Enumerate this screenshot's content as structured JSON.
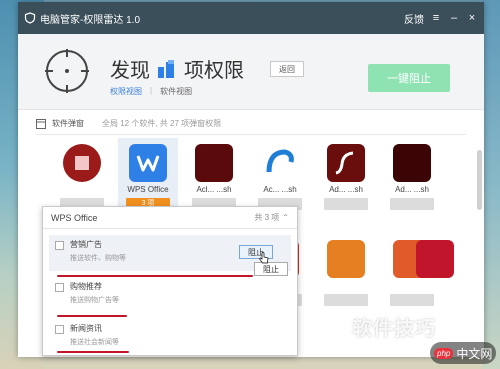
{
  "window": {
    "title": "电脑管家-权限雷达 1.0",
    "feedback": "反馈",
    "menu_icon": "menu-icon",
    "minimize_icon": "minimize-icon",
    "close_icon": "close-icon"
  },
  "header": {
    "title_part1": "发现",
    "title_part2": "项权限",
    "rescan_label": "返回",
    "links": [
      "权限视图",
      "软件视图"
    ],
    "primary_button": "一键阻止",
    "primary_color": "#8fe3b3"
  },
  "section": {
    "title": "软件弹窗",
    "subtitle": "全局 12 个软件, 共 27 项弹窗权限"
  },
  "apps": [
    {
      "name": "",
      "tag": "",
      "icon": "red-app-icon",
      "color": "#9b1b1b"
    },
    {
      "name": "WPS Office",
      "tag": "3 项",
      "icon": "wps-icon",
      "color": "#2f80e6",
      "selected": true
    },
    {
      "name": "Acl... ...sh",
      "tag": "",
      "icon": "acrobat-icon",
      "color": "#5a0a0a"
    },
    {
      "name": "Ac... ...sh",
      "tag": "",
      "icon": "blue-swirl-icon",
      "color": "#1f7ed6"
    },
    {
      "name": "Ad... ...sh",
      "tag": "",
      "icon": "flash-icon",
      "color": "#6a0d0d"
    },
    {
      "name": "Ad... ...sh",
      "tag": "",
      "icon": "dark-red-icon",
      "color": "#3b0505"
    },
    {
      "name": "",
      "tag": "",
      "icon": "generic-app-icon",
      "color": "#c0392b"
    },
    {
      "name": "",
      "tag": "",
      "icon": "generic-app-icon",
      "color": "#e67e22"
    },
    {
      "name": "",
      "tag": "",
      "icon": "generic-app-icon",
      "color": "#e05a2a"
    },
    {
      "name": "",
      "tag": "",
      "icon": "generic-app-icon",
      "color": "#c0152a"
    }
  ],
  "popup": {
    "title": "WPS Office",
    "count": "共 3 项",
    "rows": [
      {
        "label": "营销广告",
        "desc": "推送软件、购物等"
      },
      {
        "label": "购物推荐",
        "desc": "推送购物广告等"
      },
      {
        "label": "新闻资讯",
        "desc": "推送社会新闻等"
      }
    ],
    "block_label": "阻止",
    "block_label_2": "阻止"
  },
  "watermark": {
    "text": "软件技巧",
    "brand_php": "php",
    "brand_cn": "中文网"
  }
}
